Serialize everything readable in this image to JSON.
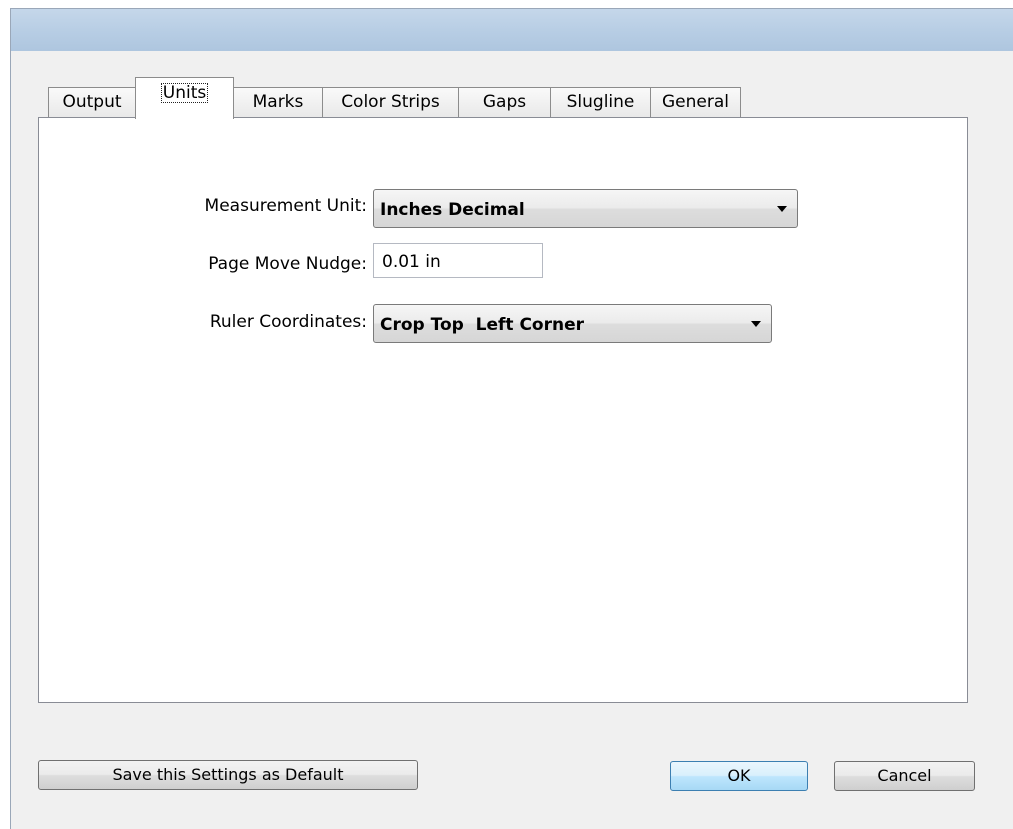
{
  "tabs": [
    {
      "label": "Output"
    },
    {
      "label": "Units"
    },
    {
      "label": "Marks"
    },
    {
      "label": "Color Strips"
    },
    {
      "label": "Gaps"
    },
    {
      "label": "Slugline"
    },
    {
      "label": "General"
    }
  ],
  "active_tab": "Units",
  "units": {
    "measurement_unit_label": "Measurement Unit:",
    "measurement_unit_value": "Inches Decimal",
    "page_move_nudge_label": "Page Move Nudge:",
    "page_move_nudge_value": "0.01 in",
    "ruler_coordinates_label": "Ruler Coordinates:",
    "ruler_coordinates_value": "Crop Top  Left Corner"
  },
  "buttons": {
    "save_default": "Save this Settings as Default",
    "ok": "OK",
    "cancel": "Cancel"
  }
}
